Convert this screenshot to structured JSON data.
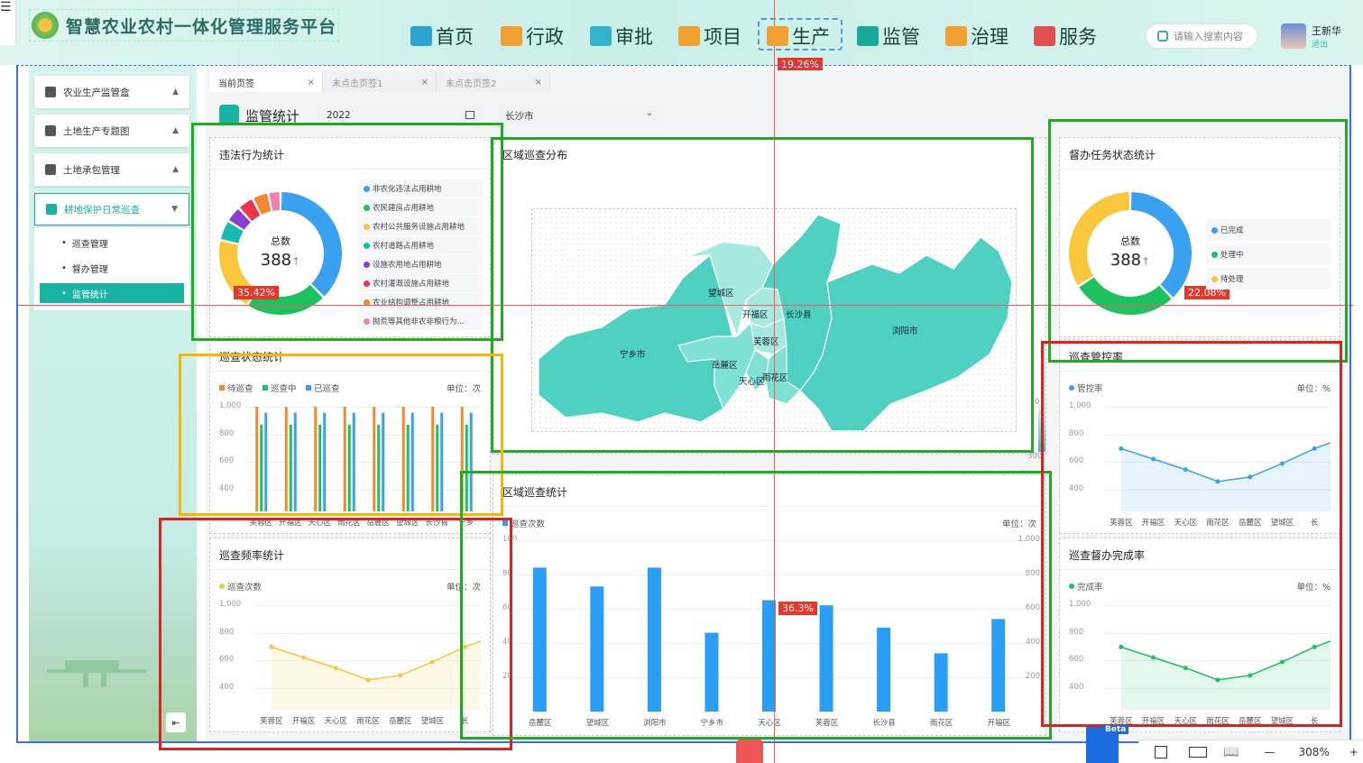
{
  "app": {
    "title": "智慧农业农村一体化管理服务平台"
  },
  "nav": {
    "items": [
      {
        "label": "首页",
        "color": "#2aa3d0"
      },
      {
        "label": "行政",
        "color": "#f0a030"
      },
      {
        "label": "审批",
        "color": "#33b4c8"
      },
      {
        "label": "项目",
        "color": "#f0a030"
      },
      {
        "label": "生产",
        "color": "#f0a030"
      },
      {
        "label": "监管",
        "color": "#1aa89a"
      },
      {
        "label": "治理",
        "color": "#f0a030"
      },
      {
        "label": "服务",
        "color": "#e05050"
      }
    ],
    "active_index": 4,
    "active_badge": "19.26%"
  },
  "search": {
    "placeholder": "请输入搜索内容",
    "icon": "search-icon"
  },
  "user": {
    "name": "王新华",
    "logout": "退出"
  },
  "sidebar": {
    "menus": [
      {
        "label": "农业生产监管盒",
        "arrow": "▲"
      },
      {
        "label": "土地生产专题图",
        "arrow": "▲"
      },
      {
        "label": "土地承包管理",
        "arrow": "▲"
      },
      {
        "label": "耕地保护日常巡查",
        "arrow": "▼"
      }
    ],
    "submenu": [
      "巡查管理",
      "督办管理",
      "监管统计"
    ],
    "active_sub": 2,
    "collapse_icon": "collapse-icon"
  },
  "tabs": [
    {
      "label": "当前页签",
      "close": "×"
    },
    {
      "label": "未点击页签1",
      "close": "×"
    },
    {
      "label": "未点击页签2",
      "close": "×"
    }
  ],
  "page": {
    "title": "监管统计",
    "year": "2022",
    "city": "长沙市"
  },
  "violation": {
    "title": "违法行为统计",
    "center_label": "总数",
    "center_value": "388",
    "center_arrow": "↑",
    "badge": "35.42%",
    "legend": [
      {
        "label": "非农化违法占用耕地",
        "color": "#3aa1f0",
        "value": 35
      },
      {
        "label": "农民建房占用耕地",
        "color": "#1cc160",
        "value": 20
      },
      {
        "label": "农村公共服务设施占用耕地",
        "color": "#f9c63c",
        "value": 18
      },
      {
        "label": "农村道路占用耕地",
        "color": "#19b9b0",
        "value": 5
      },
      {
        "label": "设施农用地占用耕地",
        "color": "#8a3fd0",
        "value": 4
      },
      {
        "label": "农村灌溉设施占用耕地",
        "color": "#e8364a",
        "value": 4
      },
      {
        "label": "农业结构调整占用耕地",
        "color": "#f08a30",
        "value": 4
      },
      {
        "label": "抛荒等其他非农非粮行为...",
        "color": "#f07fb0",
        "value": 3
      }
    ]
  },
  "region_map": {
    "title": "区域巡查分布",
    "regions": [
      "望城区",
      "开福区",
      "长沙县",
      "芙蓉区",
      "浏阳市",
      "宁乡市",
      "岳麓区",
      "天心区",
      "雨花区"
    ],
    "scale_top": "0",
    "scale_bottom": "300"
  },
  "supervise": {
    "title": "督办任务状态统计",
    "center_label": "总数",
    "center_value": "388",
    "center_arrow": "↑",
    "badge": "22.08%",
    "legend": [
      {
        "label": "已完成",
        "color": "#3aa1f0",
        "value": 38
      },
      {
        "label": "处理中",
        "color": "#1cc160",
        "value": 28
      },
      {
        "label": "待处理",
        "color": "#f9c63c",
        "value": 34
      }
    ]
  },
  "patrol_status": {
    "title": "巡查状态统计",
    "unit": "单位：次",
    "series": [
      {
        "name": "待巡查",
        "color": "#f08a30"
      },
      {
        "name": "巡查中",
        "color": "#1cc160"
      },
      {
        "name": "已巡查",
        "color": "#3aa1f0"
      }
    ],
    "yticks": [
      "1,000",
      "800",
      "600",
      "400"
    ],
    "categories": [
      "芙蓉区",
      "开福区",
      "天心区",
      "雨花区",
      "岳麓区",
      "望城区",
      "长沙县",
      "宁乡"
    ]
  },
  "patrol_rate": {
    "title": "巡查管控率",
    "series_name": "管控率",
    "unit": "单位：%",
    "color": "#3aa1f0",
    "yticks": [
      "1,000",
      "800",
      "600",
      "400"
    ],
    "categories": [
      "芙蓉区",
      "开福区",
      "天心区",
      "雨花区",
      "岳麓区",
      "望城区",
      "长"
    ]
  },
  "patrol_freq": {
    "title": "巡查频率统计",
    "series_name": "巡查次数",
    "unit": "单位：次",
    "color": "#f9c63c",
    "yticks": [
      "1,000",
      "800",
      "600",
      "400"
    ],
    "categories": [
      "芙蓉区",
      "开福区",
      "天心区",
      "雨花区",
      "岳麓区",
      "望城区",
      "长"
    ]
  },
  "region_stat": {
    "title": "区域巡查统计",
    "series_name": "巡查次数",
    "unit": "单位：次",
    "color": "#2a9df4",
    "badge": "36.3%",
    "yticks_left": [
      "100",
      "80",
      "60",
      "40",
      "20"
    ],
    "yticks_right": [
      "1,000",
      "800",
      "600",
      "400",
      "200"
    ],
    "categories": [
      "岳麓区",
      "望城区",
      "浏阳市",
      "宁乡市",
      "天心区",
      "芙蓉区",
      "长沙县",
      "雨花区",
      "开福区"
    ]
  },
  "complete_rate": {
    "title": "巡查督办完成率",
    "series_name": "完成率",
    "unit": "单位：%",
    "color": "#1cc160",
    "yticks": [
      "1,000",
      "800",
      "600",
      "400"
    ],
    "categories": [
      "芙蓉区",
      "开福区",
      "天心区",
      "雨花区",
      "岳麓区",
      "望城区",
      "长"
    ]
  },
  "chart_data": [
    {
      "type": "pie",
      "title": "违法行为统计",
      "categories": [
        "非农化违法占用耕地",
        "农民建房占用耕地",
        "农村公共服务设施占用耕地",
        "农村道路占用耕地",
        "设施农用地占用耕地",
        "农村灌溉设施占用耕地",
        "农业结构调整占用耕地",
        "抛荒等其他非农非粮行为..."
      ],
      "values": [
        35,
        20,
        18,
        5,
        4,
        4,
        4,
        3
      ]
    },
    {
      "type": "pie",
      "title": "督办任务状态统计",
      "categories": [
        "已完成",
        "处理中",
        "待处理"
      ],
      "values": [
        38,
        28,
        34
      ]
    },
    {
      "type": "bar",
      "title": "巡查状态统计",
      "categories": [
        "芙蓉区",
        "开福区",
        "天心区",
        "雨花区",
        "岳麓区",
        "望城区",
        "长沙县",
        "宁乡"
      ],
      "series": [
        {
          "name": "待巡查",
          "values": [
            1000,
            1000,
            1000,
            1000,
            1000,
            1000,
            1000,
            1000
          ]
        },
        {
          "name": "巡查中",
          "values": [
            880,
            880,
            880,
            880,
            880,
            880,
            880,
            880
          ]
        },
        {
          "name": "已巡查",
          "values": [
            960,
            960,
            960,
            960,
            960,
            960,
            960,
            960
          ]
        }
      ],
      "ylim": [
        300,
        1000
      ]
    },
    {
      "type": "area",
      "title": "巡查管控率",
      "categories": [
        "芙蓉区",
        "开福区",
        "天心区",
        "雨花区",
        "岳麓区",
        "望城区",
        "长"
      ],
      "series": [
        {
          "name": "管控率",
          "values": [
            720,
            650,
            580,
            500,
            530,
            620,
            720
          ]
        }
      ],
      "ylim": [
        300,
        1000
      ]
    },
    {
      "type": "area",
      "title": "巡查频率统计",
      "categories": [
        "芙蓉区",
        "开福区",
        "天心区",
        "雨花区",
        "岳麓区",
        "望城区",
        "长"
      ],
      "series": [
        {
          "name": "巡查次数",
          "values": [
            720,
            650,
            580,
            500,
            530,
            620,
            720
          ]
        }
      ],
      "ylim": [
        300,
        1000
      ]
    },
    {
      "type": "bar",
      "title": "区域巡查统计",
      "categories": [
        "岳麓区",
        "望城区",
        "浏阳市",
        "宁乡市",
        "天心区",
        "芙蓉区",
        "长沙县",
        "雨花区",
        "开福区"
      ],
      "series": [
        {
          "name": "巡查次数",
          "values": [
            84,
            73,
            84,
            46,
            65,
            62,
            49,
            34,
            54
          ]
        }
      ],
      "ylim": [
        0,
        100
      ]
    },
    {
      "type": "area",
      "title": "巡查督办完成率",
      "categories": [
        "芙蓉区",
        "开福区",
        "天心区",
        "雨花区",
        "岳麓区",
        "望城区",
        "长"
      ],
      "series": [
        {
          "name": "完成率",
          "values": [
            720,
            650,
            580,
            500,
            530,
            620,
            720
          ]
        }
      ],
      "ylim": [
        300,
        1000
      ]
    }
  ],
  "bottom": {
    "zoom": "308%",
    "beta": "Beta",
    "minus": "—",
    "plus": "+"
  }
}
